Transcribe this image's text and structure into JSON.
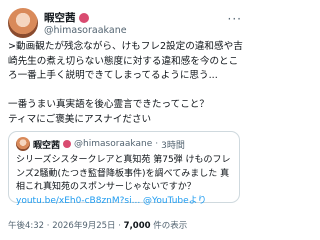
{
  "tweet": {
    "author_name": "暇空茜",
    "author_handle": "@himasoraakane",
    "more_icon": "more-horizontal-icon",
    "text": ">動画観たが残念ながら、けもフレ2設定の違和感や吉崎先生の煮え切らない態度に対する違和感を今のところ一番上手く説明できてしまってるように思う...\n\n一番うまい真実語を後心霊言できたってこと？\nティマにご褒美にアスナイださい"
  },
  "quote": {
    "author_name": "暇空茜",
    "author_handle": "@himasoraakane",
    "time_ago": "3時間",
    "text_prefix": "シリーズシスタークレアと真知苑 第75弾 けものフレンズ2騒動(たつき監督降板事件)を調べてみました 真相これ真知苑のスポンサーじゃないですか？ ",
    "link_text": "youtu.be/xEh0-cB8znM?si... @YouTubeより"
  },
  "footer": {
    "timestamp": "午後4:32 · 2026年9月25日 · ",
    "views_count": "7,000",
    "views_label": " 件の表示"
  }
}
